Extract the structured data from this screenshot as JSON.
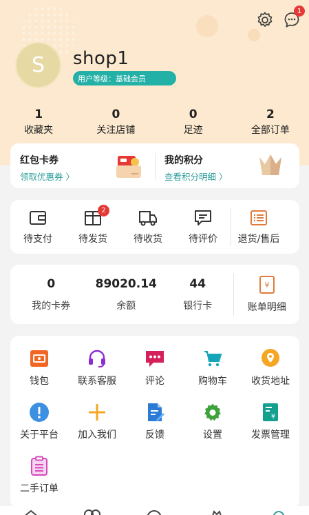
{
  "header": {
    "messages_badge": "1"
  },
  "profile": {
    "avatar_letter": "S",
    "shop_name": "shop1",
    "level": "用户等级：基础会员"
  },
  "stats": [
    {
      "num": "1",
      "label": "收藏夹"
    },
    {
      "num": "0",
      "label": "关注店铺"
    },
    {
      "num": "0",
      "label": "足迹"
    },
    {
      "num": "2",
      "label": "全部订单"
    }
  ],
  "coupon": {
    "title": "红包卡券",
    "link": "领取优惠券 〉",
    "points_title": "我的积分",
    "points_link": "查看积分明细 〉"
  },
  "orders": [
    {
      "label": "待支付",
      "icon": "wallet-icon"
    },
    {
      "label": "待发货",
      "icon": "box-icon",
      "badge": "2"
    },
    {
      "label": "待收货",
      "icon": "truck-icon"
    },
    {
      "label": "待评价",
      "icon": "comment-icon"
    },
    {
      "label": "退货/售后",
      "icon": "return-icon"
    }
  ],
  "wallet": [
    {
      "num": "0",
      "label": "我的卡券"
    },
    {
      "num": "89020.14",
      "label": "余额"
    },
    {
      "num": "44",
      "label": "银行卡"
    }
  ],
  "bill_label": "账单明细",
  "tools": [
    {
      "label": "钱包",
      "icon": "wallet-icon"
    },
    {
      "label": "联系客服",
      "icon": "headset-icon"
    },
    {
      "label": "评论",
      "icon": "chat-icon"
    },
    {
      "label": "购物车",
      "icon": "cart-icon"
    },
    {
      "label": "收货地址",
      "icon": "location-icon"
    },
    {
      "label": "关于平台",
      "icon": "info-icon"
    },
    {
      "label": "加入我们",
      "icon": "plus-icon"
    },
    {
      "label": "反馈",
      "icon": "feedback-icon"
    },
    {
      "label": "设置",
      "icon": "gear-icon"
    },
    {
      "label": "发票管理",
      "icon": "invoice-icon"
    },
    {
      "label": "二手订单",
      "icon": "order-list-icon"
    }
  ],
  "colors": {
    "accent": "#2a9d9a",
    "hero_bg": "#fce9cf",
    "badge": "#e53935"
  }
}
